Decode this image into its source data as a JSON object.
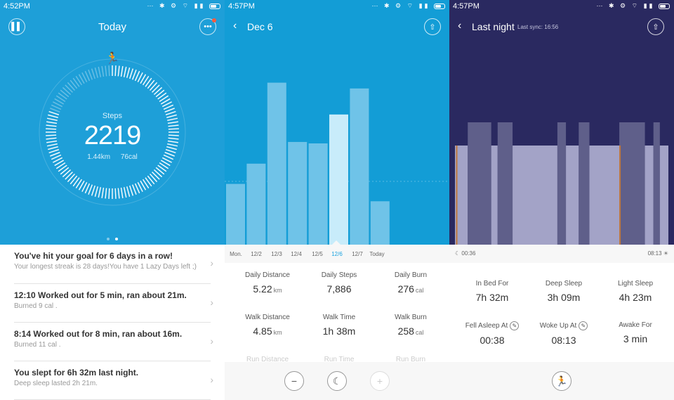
{
  "status_bars": [
    {
      "time": "4:52PM"
    },
    {
      "time": "4:57PM"
    },
    {
      "time": "4:57PM"
    }
  ],
  "status_icons": "⋯ ✱ ⚙ ⌔ ▮▮",
  "today": {
    "title": "Today",
    "steps_label": "Steps",
    "steps_value": "2219",
    "distance": "1.44km",
    "calories": "76cal",
    "steps_goal_fraction": 0.8,
    "feed": [
      {
        "title": "You've hit your goal for 6 days in a row!",
        "sub": "Your longest streak is 28 days!You have 1 Lazy Days left ;)"
      },
      {
        "title": "12:10  Worked out for 5 min, ran about 21m.",
        "sub": "Burned 9 cal ."
      },
      {
        "title": "8:14  Worked out for 8 min, ran about 16m.",
        "sub": "Burned 11 cal ."
      },
      {
        "title": "You slept for 6h 32m last night.",
        "sub": "Deep sleep lasted 2h 21m."
      }
    ]
  },
  "day": {
    "title": "Dec 6",
    "ticks": [
      "Mon.",
      "12/2",
      "12/3",
      "12/4",
      "12/5",
      "12/6",
      "12/7",
      "Today"
    ],
    "selected_tick": "12/6",
    "stats": [
      {
        "label": "Daily Distance",
        "value": "5.22",
        "unit": "km"
      },
      {
        "label": "Daily Steps",
        "value": "7,886",
        "unit": ""
      },
      {
        "label": "Daily Burn",
        "value": "276",
        "unit": "cal"
      },
      {
        "label": "Walk Distance",
        "value": "4.85",
        "unit": "km"
      },
      {
        "label": "Walk Time",
        "value": "1h 38m",
        "unit": ""
      },
      {
        "label": "Walk Burn",
        "value": "258",
        "unit": "cal"
      },
      {
        "label": "Run Distance",
        "value": "",
        "unit": ""
      },
      {
        "label": "Run Time",
        "value": "",
        "unit": ""
      },
      {
        "label": "Run Burn",
        "value": "",
        "unit": ""
      }
    ]
  },
  "sleep": {
    "title": "Last night",
    "last_sync": "Last sync: 16:56",
    "start_time": "00:36",
    "end_time": "08:13",
    "stats": [
      {
        "label": "In Bed For",
        "value": "7h 32m"
      },
      {
        "label": "Deep Sleep",
        "value": "3h 09m"
      },
      {
        "label": "Light Sleep",
        "value": "4h 23m"
      },
      {
        "label": "Fell Asleep At",
        "value": "00:38"
      },
      {
        "label": "Woke Up At",
        "value": "08:13"
      },
      {
        "label": "Awake For",
        "value": "3 min"
      }
    ]
  },
  "chart_data": [
    {
      "type": "bar",
      "title": "",
      "categories": [
        "Mon.",
        "12/2",
        "12/3",
        "12/4",
        "12/5",
        "12/6",
        "12/7",
        "Today"
      ],
      "values": [
        4200,
        5600,
        11200,
        7100,
        7000,
        9000,
        10800,
        3000
      ],
      "ylim": [
        0,
        14000
      ],
      "highlight": "12/6",
      "colors": {
        "bar": "#6fc3e8",
        "selected": "#c8ecfa"
      }
    },
    {
      "type": "bar",
      "title": "",
      "x_start": "00:36",
      "x_end": "08:13",
      "segments": [
        {
          "stage": "light",
          "start": 0.0,
          "end": 0.06
        },
        {
          "stage": "deep",
          "start": 0.06,
          "end": 0.17
        },
        {
          "stage": "light",
          "start": 0.17,
          "end": 0.2
        },
        {
          "stage": "deep",
          "start": 0.2,
          "end": 0.27
        },
        {
          "stage": "light",
          "start": 0.27,
          "end": 0.48
        },
        {
          "stage": "deep",
          "start": 0.48,
          "end": 0.52
        },
        {
          "stage": "light",
          "start": 0.52,
          "end": 0.58
        },
        {
          "stage": "deep",
          "start": 0.58,
          "end": 0.63
        },
        {
          "stage": "light",
          "start": 0.63,
          "end": 0.77
        },
        {
          "stage": "deep",
          "start": 0.77,
          "end": 0.89
        },
        {
          "stage": "light",
          "start": 0.89,
          "end": 0.93
        },
        {
          "stage": "deep",
          "start": 0.93,
          "end": 0.96
        },
        {
          "stage": "light",
          "start": 0.96,
          "end": 1.0
        }
      ],
      "colors": {
        "light": "#a3a3c7",
        "deep": "#5f5f8a",
        "awake": "#c0793e"
      }
    }
  ]
}
